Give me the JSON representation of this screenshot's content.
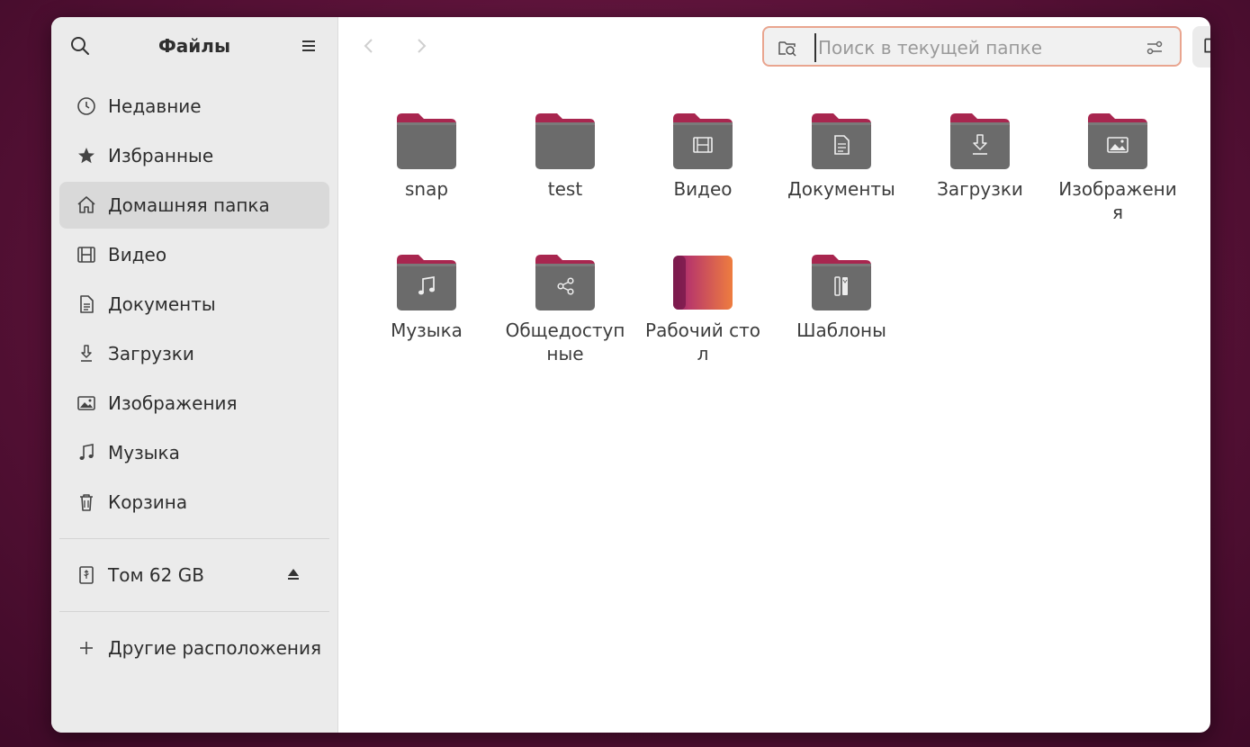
{
  "sidebar": {
    "title": "Файлы",
    "items": [
      {
        "label": "Недавние",
        "icon": "clock-icon"
      },
      {
        "label": "Избранные",
        "icon": "star-icon"
      },
      {
        "label": "Домашняя папка",
        "icon": "home-icon",
        "active": true
      },
      {
        "label": "Видео",
        "icon": "film-icon"
      },
      {
        "label": "Документы",
        "icon": "document-icon"
      },
      {
        "label": "Загрузки",
        "icon": "download-icon"
      },
      {
        "label": "Изображения",
        "icon": "image-icon"
      },
      {
        "label": "Музыка",
        "icon": "music-note-icon"
      },
      {
        "label": "Корзина",
        "icon": "trash-icon"
      }
    ],
    "volume": {
      "label": "Том 62 GB",
      "icon": "usb-drive-icon"
    },
    "other": {
      "label": "Другие расположения",
      "icon": "plus-icon"
    }
  },
  "toolbar": {
    "search_placeholder": "Поиск в текущей папке"
  },
  "files": [
    {
      "name": "snap",
      "icon": "folder-icon"
    },
    {
      "name": "test",
      "icon": "folder-icon"
    },
    {
      "name": "Видео",
      "icon": "video-folder-icon"
    },
    {
      "name": "Документы",
      "icon": "documents-folder-icon"
    },
    {
      "name": "Загрузки",
      "icon": "downloads-folder-icon"
    },
    {
      "name": "Изображения",
      "icon": "pictures-folder-icon"
    },
    {
      "name": "Музыка",
      "icon": "music-folder-icon"
    },
    {
      "name": "Общедоступные",
      "icon": "public-folder-icon"
    },
    {
      "name": "Рабочий стол",
      "icon": "desktop-folder-icon"
    },
    {
      "name": "Шаблоны",
      "icon": "templates-folder-icon"
    }
  ],
  "colors": {
    "folder_body": "#6b6b6b",
    "folder_tab": "#a8264f",
    "search_border": "#e9a58f",
    "sidebar_bg": "#ebebeb",
    "active_item": "#d9d9d9"
  }
}
